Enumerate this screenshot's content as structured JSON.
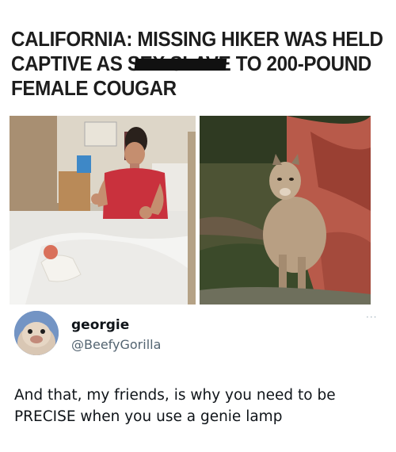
{
  "headline": {
    "line1": "CALIFORNIA: MISSING HIKER WAS HELD",
    "line2_prefix": "CAPTIVE AS ",
    "line2_censored": "SEX SLAVE",
    "line2_suffix": " TO 200-POUND",
    "line3": "FEMALE COUGAR"
  },
  "photos": [
    {
      "subject": "hospital-bed-man-thumbs-up"
    },
    {
      "subject": "mountain-lion"
    }
  ],
  "tweet": {
    "display_name": "georgie",
    "handle": "@BeefyGorilla",
    "more_icon": "···",
    "text_line1": "And that, my friends, is why you need to be",
    "text_line2": "PRECISE when you use a genie lamp"
  }
}
